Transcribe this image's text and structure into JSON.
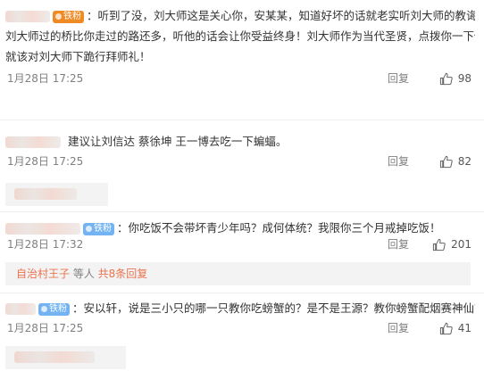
{
  "comments": [
    {
      "badge": "铁粉",
      "text_line1": "：听到了没，刘大师这是关心你，安某某，知道好坏的话就老实听刘大师的教诲，",
      "text_line2": "刘大师过的桥比你走过的路还多，听他的话会让你受益终身！刘大师作为当代圣贤，点拨你一下你",
      "text_line3": "就该对刘大师下跪行拜师礼！",
      "time": "1月28日 17:25",
      "reply": "回复",
      "likes": "98"
    },
    {
      "text_line1": "建议让刘信达 蔡徐坤 王一博去吃一下蝙蝠。",
      "time": "1月28日 17:25",
      "reply": "回复",
      "likes": "82"
    },
    {
      "badge": "铁粉",
      "text_line1": "：你吃饭不会带坏青少年吗？成何体统？我限你三个月戒掉吃饭！",
      "time": "1月28日 17:32",
      "reply": "回复",
      "likes": "201",
      "sub_reply": {
        "user": "自治村王子",
        "middle": " 等人 ",
        "count": "共8条回复"
      }
    },
    {
      "badge": "铁粉",
      "text_line1": "：安以轩，说是三小只的哪一只教你吃螃蟹的？是不是王源？教你螃蟹配烟赛神仙？",
      "time": "1月28日 17:25",
      "reply": "回复",
      "likes": "41"
    }
  ],
  "colors": {
    "orange_badge": "#f08a24",
    "blue_badge": "#73b3f2",
    "link": "#eb7350",
    "meta": "#808080"
  },
  "icons": {
    "like": "thumbs-up-icon"
  }
}
